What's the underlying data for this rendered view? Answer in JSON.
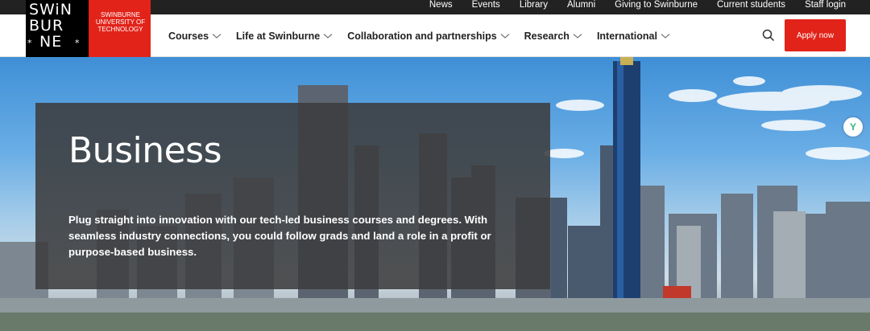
{
  "utility_nav": {
    "items": [
      "News",
      "Events",
      "Library",
      "Alumni",
      "Giving to Swinburne",
      "Current students",
      "Staff login"
    ]
  },
  "logo": {
    "wordmark_lines": [
      "SWiN",
      "BUR",
      "NE"
    ],
    "stars": "* *",
    "red_text_lines": [
      "SWINBURNE",
      "UNIVERSITY OF",
      "TECHNOLOGY"
    ]
  },
  "main_nav": {
    "items": [
      {
        "label": "Courses"
      },
      {
        "label": "Life at Swinburne"
      },
      {
        "label": "Collaboration and partnerships"
      },
      {
        "label": "Research"
      },
      {
        "label": "International"
      }
    ]
  },
  "header": {
    "apply_label": "Apply now"
  },
  "hero": {
    "title": "Business",
    "description": "Plug straight into innovation with our tech-led business courses and degrees. With seamless industry connections, you could follow grads and land a role in a profit or purpose-based business."
  },
  "widget": {
    "label": "Y"
  },
  "colors": {
    "brand_red": "#e2231a",
    "utility_bar": "#222222",
    "panel": "#3c3c3e"
  }
}
